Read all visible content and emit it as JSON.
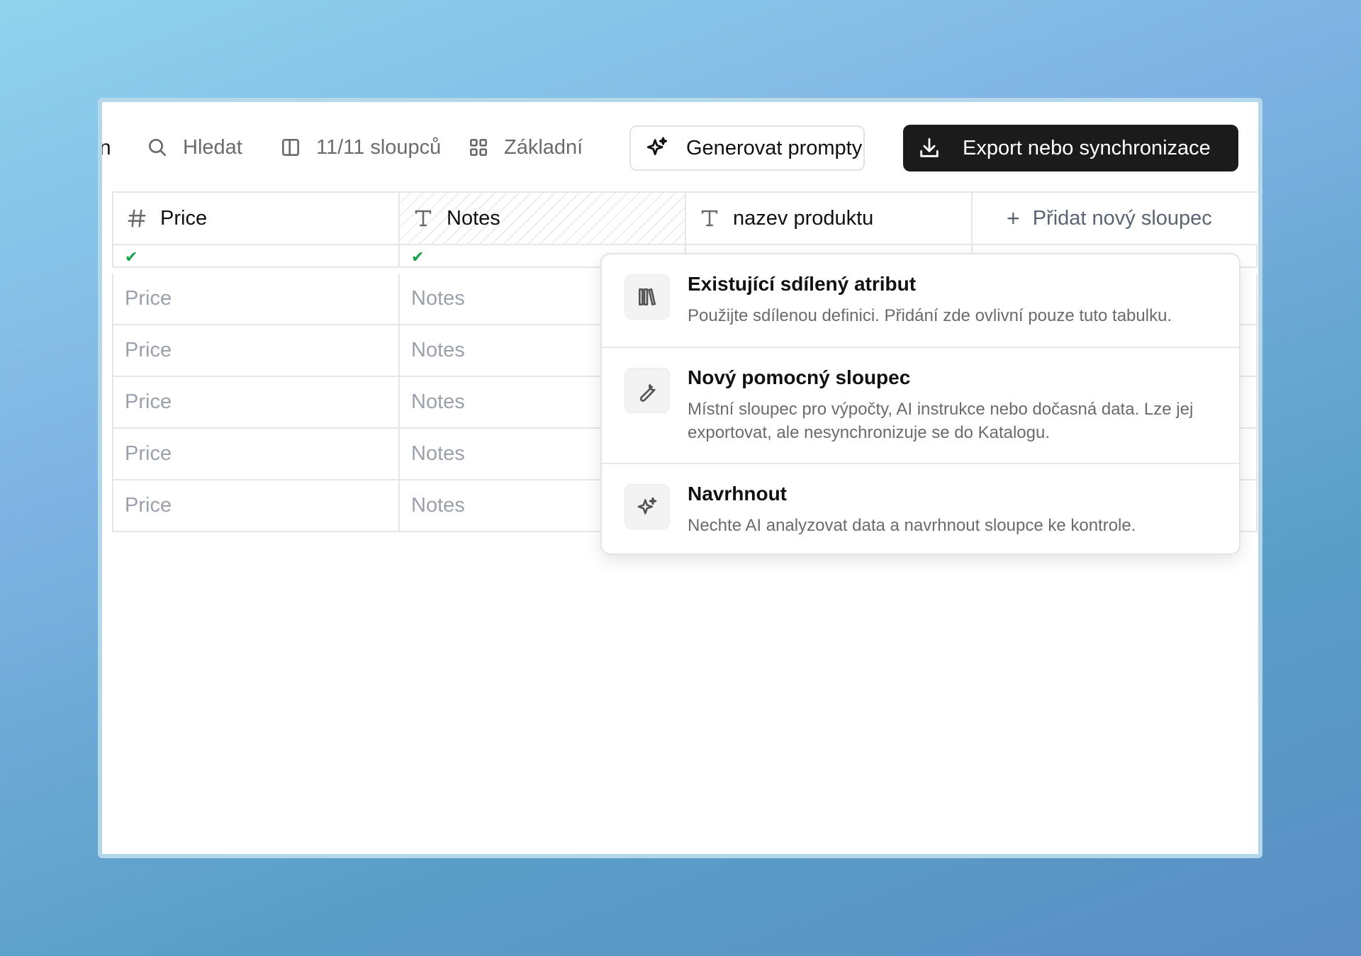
{
  "toolbar": {
    "cut_glyph": "n",
    "search_label": "Hledat",
    "columns_label": "11/11 sloupců",
    "view_label": "Základní",
    "generate_label": "Generovat prompty",
    "export_label": "Export nebo synchronizace"
  },
  "columns": {
    "price": "Price",
    "notes": "Notes",
    "nazev": "nazev produktu",
    "add": "Přidat nový sloupec"
  },
  "check_mark": "✔",
  "rows": [
    {
      "price": "Price",
      "notes": "Notes"
    },
    {
      "price": "Price",
      "notes": "Notes"
    },
    {
      "price": "Price",
      "notes": "Notes"
    },
    {
      "price": "Price",
      "notes": "Notes"
    },
    {
      "price": "Price",
      "notes": "Notes"
    }
  ],
  "menu": {
    "items": [
      {
        "title": "Existující sdílený atribut",
        "desc": "Použijte sdílenou definici. Přidání zde ovlivní pouze tuto tabulku.",
        "icon": "library-icon"
      },
      {
        "title": "Nový pomocný sloupec",
        "desc": "Místní sloupec pro výpočty, AI instrukce nebo dočasná data. Lze jej exportovat, ale nesynchronizuje se do Katalogu.",
        "icon": "wrench-icon"
      },
      {
        "title": "Navrhnout",
        "desc": "Nechte AI analyzovat data a navrhnout sloupce ke kontrole.",
        "icon": "sparkles-icon"
      }
    ]
  },
  "colors": {
    "accent_dark": "#1b1b1b",
    "check_green": "#16a34a",
    "placeholder_gray": "#9aa1ab"
  }
}
